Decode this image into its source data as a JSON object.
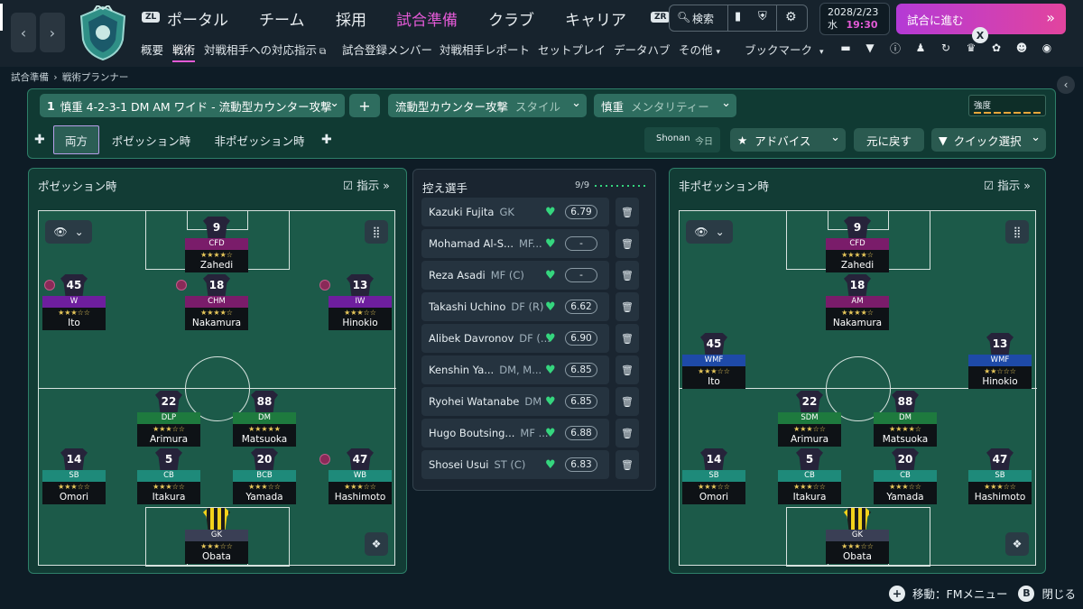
{
  "header": {
    "nav_left": "‹",
    "nav_right": "›",
    "zl": "ZL",
    "zr": "ZR",
    "main_nav": [
      "ポータル",
      "チーム",
      "採用",
      "試合準備",
      "クラブ",
      "キャリア"
    ],
    "sub_nav": [
      "概要",
      "戦術",
      "対戦相手への対応指示",
      "試合登録メンバー",
      "対戦相手レポート",
      "セットプレイ",
      "データハブ",
      "その他"
    ],
    "bookmark": "ブックマーク",
    "search": "検索",
    "date": "2028/2/23",
    "weekday": "水",
    "time": "19:30",
    "continue": "試合に進む",
    "x": "X"
  },
  "breadcrumb": {
    "parent": "試合準備",
    "current": "戦術プランナー"
  },
  "tactic_bar": {
    "tactic_index": "1",
    "tactic_name": "慎重 4-2-3-1 DM AM ワイド - 流動型カウンター攻撃",
    "plus": "+",
    "style_value": "流動型カウンター攻撃",
    "style_label": "スタイル",
    "mentality_value": "慎重",
    "mentality_label": "メンタリティー",
    "strength": "強度",
    "tabs": [
      "両方",
      "ポゼッション時",
      "非ポゼッション時"
    ],
    "shonan": "Shonan",
    "today": "今日",
    "advice": "アドバイス",
    "undo": "元に戻す",
    "quick_select": "クイック選択"
  },
  "left_panel": {
    "title": "ポゼッション時",
    "instructions": "指示",
    "players": [
      {
        "num": "9",
        "role": "CFD",
        "stars": "★★★★☆",
        "name": "Zahedi",
        "color": "#7a1c6a"
      },
      {
        "num": "45",
        "role": "W",
        "stars": "★★★☆☆",
        "name": "Ito",
        "color": "#6e1e9e"
      },
      {
        "num": "18",
        "role": "CHM",
        "stars": "★★★★☆",
        "name": "Nakamura",
        "color": "#7a1c6a"
      },
      {
        "num": "13",
        "role": "IW",
        "stars": "★★★☆☆",
        "name": "Hinokio",
        "color": "#6e1e9e"
      },
      {
        "num": "22",
        "role": "DLP",
        "stars": "★★★☆☆",
        "name": "Arimura",
        "color": "#1e7a3e"
      },
      {
        "num": "88",
        "role": "DM",
        "stars": "★★★★★",
        "name": "Matsuoka",
        "color": "#1e7a3e"
      },
      {
        "num": "14",
        "role": "SB",
        "stars": "★★★☆☆",
        "name": "Omori",
        "color": "#1e8a7a"
      },
      {
        "num": "5",
        "role": "CB",
        "stars": "★★★☆☆",
        "name": "Itakura",
        "color": "#1e8a7a"
      },
      {
        "num": "20",
        "role": "BCB",
        "stars": "★★★☆☆",
        "name": "Yamada",
        "color": "#1e8a7a"
      },
      {
        "num": "47",
        "role": "WB",
        "stars": "★★★☆☆",
        "name": "Hashimoto",
        "color": "#1e8a7a"
      },
      {
        "num": "",
        "role": "GK",
        "stars": "★★★☆☆",
        "name": "Obata",
        "color": "#3a3f55"
      }
    ]
  },
  "right_panel": {
    "title": "非ポゼッション時",
    "instructions": "指示",
    "players": [
      {
        "num": "9",
        "role": "CFD",
        "stars": "★★★★☆",
        "name": "Zahedi",
        "color": "#7a1c6a"
      },
      {
        "num": "18",
        "role": "AM",
        "stars": "★★★★☆",
        "name": "Nakamura",
        "color": "#7a1c6a"
      },
      {
        "num": "45",
        "role": "WMF",
        "stars": "★★★☆☆",
        "name": "Ito",
        "color": "#1e4aa8"
      },
      {
        "num": "13",
        "role": "WMF",
        "stars": "★★☆☆☆",
        "name": "Hinokio",
        "color": "#1e4aa8"
      },
      {
        "num": "22",
        "role": "SDM",
        "stars": "★★★☆☆",
        "name": "Arimura",
        "color": "#1e7a3e"
      },
      {
        "num": "88",
        "role": "DM",
        "stars": "★★★★☆",
        "name": "Matsuoka",
        "color": "#1e7a3e"
      },
      {
        "num": "14",
        "role": "SB",
        "stars": "★★★☆☆",
        "name": "Omori",
        "color": "#1e8a7a"
      },
      {
        "num": "5",
        "role": "CB",
        "stars": "★★★☆☆",
        "name": "Itakura",
        "color": "#1e8a7a"
      },
      {
        "num": "20",
        "role": "CB",
        "stars": "★★★☆☆",
        "name": "Yamada",
        "color": "#1e8a7a"
      },
      {
        "num": "47",
        "role": "SB",
        "stars": "★★★☆☆",
        "name": "Hashimoto",
        "color": "#1e8a7a"
      },
      {
        "num": "",
        "role": "GK",
        "stars": "★★★☆☆",
        "name": "Obata",
        "color": "#3a3f55"
      }
    ]
  },
  "bench": {
    "title": "控え選手",
    "count": "9/9",
    "players": [
      {
        "name": "Kazuki Fujita",
        "pos": "GK",
        "rating": "6.79"
      },
      {
        "name": "Mohamad Al-S...",
        "pos": "MF...",
        "rating": "-"
      },
      {
        "name": "Reza Asadi",
        "pos": "MF (C)",
        "rating": "-"
      },
      {
        "name": "Takashi Uchino",
        "pos": "DF (R)",
        "rating": "6.62"
      },
      {
        "name": "Alibek Davronov",
        "pos": "DF (...",
        "rating": "6.90"
      },
      {
        "name": "Kenshin Ya...",
        "pos": "DM, M...",
        "rating": "6.85"
      },
      {
        "name": "Ryohei Watanabe",
        "pos": "DM",
        "rating": "6.85"
      },
      {
        "name": "Hugo Boutsing...",
        "pos": "MF ...",
        "rating": "6.88"
      },
      {
        "name": "Shosei Usui",
        "pos": "ST (C)",
        "rating": "6.83"
      }
    ]
  },
  "footer": {
    "move": "移動：FMメニュー",
    "b": "B",
    "close": "閉じる"
  }
}
